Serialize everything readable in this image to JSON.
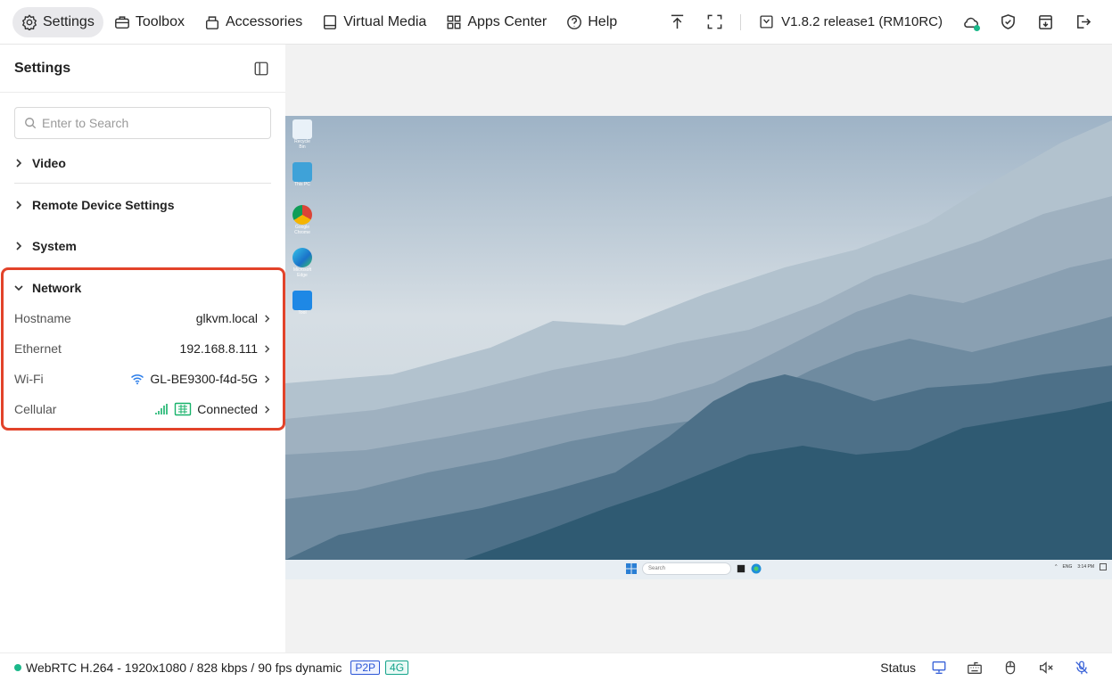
{
  "topbar": {
    "nav": [
      {
        "label": "Settings",
        "icon": "settings-icon",
        "active": true
      },
      {
        "label": "Toolbox",
        "icon": "toolbox-icon"
      },
      {
        "label": "Accessories",
        "icon": "accessories-icon"
      },
      {
        "label": "Virtual Media",
        "icon": "virtual-media-icon"
      },
      {
        "label": "Apps Center",
        "icon": "apps-center-icon"
      },
      {
        "label": "Help",
        "icon": "help-icon"
      }
    ],
    "version": "V1.8.2 release1 (RM10RC)"
  },
  "sidebar": {
    "title": "Settings",
    "search_placeholder": "Enter to Search",
    "sections": [
      {
        "label": "Video"
      },
      {
        "label": "Remote Device Settings"
      },
      {
        "label": "System"
      },
      {
        "label": "Network",
        "expanded": true
      }
    ],
    "network": [
      {
        "label": "Hostname",
        "value": "glkvm.local"
      },
      {
        "label": "Ethernet",
        "value": "192.168.8.111"
      },
      {
        "label": "Wi-Fi",
        "value": "GL-BE9300-f4d-5G"
      },
      {
        "label": "Cellular",
        "value": "Connected"
      }
    ]
  },
  "desktop": {
    "icons": [
      "Recycle Bin",
      "This PC",
      "Google Chrome",
      "Microsoft Edge",
      "Tool"
    ],
    "taskbar_search": "Search",
    "tray_lang": "ENG",
    "tray_time": "3:14 PM"
  },
  "statusbar": {
    "stream": "WebRTC H.264 - 1920x1080 / 828 kbps / 90 fps dynamic",
    "badge_p2p": "P2P",
    "badge_4g": "4G",
    "status_label": "Status"
  },
  "colors": {
    "accent_green": "#1bb88a",
    "highlight_red": "#e2432a",
    "p2p_blue": "#2b56d6",
    "cellular_teal": "#17b26a"
  }
}
